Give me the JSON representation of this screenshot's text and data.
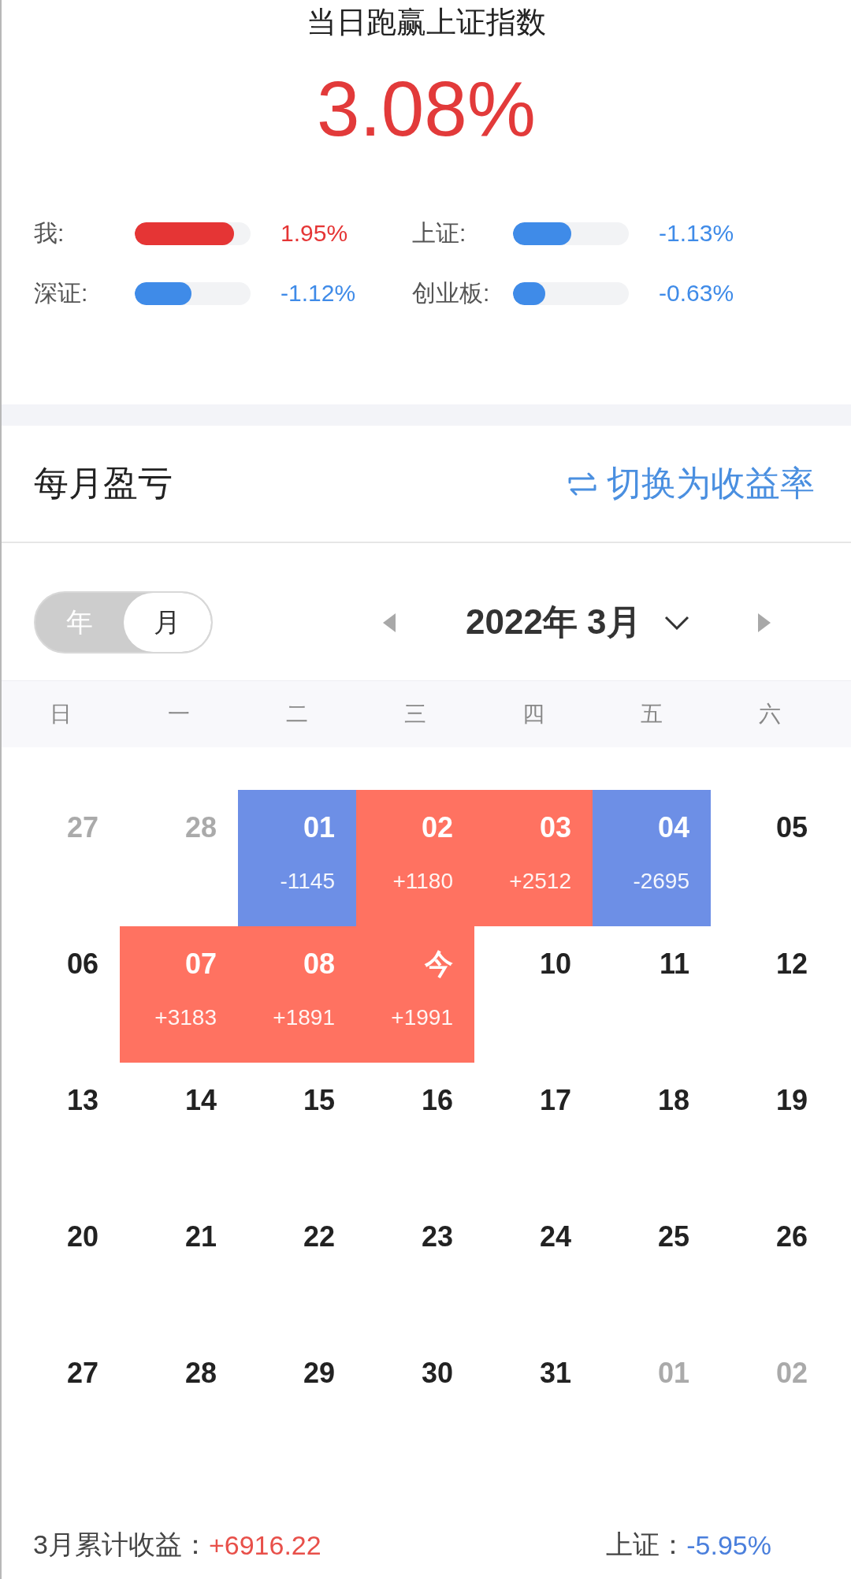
{
  "header": {
    "title": "当日跑赢上证指数",
    "value": "3.08%"
  },
  "comparisons": [
    {
      "label": "我:",
      "level": 0.86,
      "reading": "1.95%",
      "color": "#e53535"
    },
    {
      "label": "上证:",
      "level": 0.5,
      "reading": "-1.13%",
      "color": "#3f8be8"
    },
    {
      "label": "深证:",
      "level": 0.49,
      "reading": "-1.12%",
      "color": "#3f8be8"
    },
    {
      "label": "创业板:",
      "level": 0.28,
      "reading": "-0.63%",
      "color": "#3f8be8"
    }
  ],
  "section": {
    "title": "每月盈亏",
    "switch_link": "切换为收益率"
  },
  "mode_toggle": [
    {
      "label": "年",
      "selected": false
    },
    {
      "label": "月",
      "selected": true
    }
  ],
  "month_nav": {
    "label": "2022年 3月"
  },
  "weekdays": [
    "日",
    "一",
    "二",
    "三",
    "四",
    "五",
    "六"
  ],
  "weeks": [
    [
      {
        "day": "27",
        "kind": "outside"
      },
      {
        "day": "28",
        "kind": "outside"
      },
      {
        "day": "01",
        "kind": "loss",
        "pnl": "-1145"
      },
      {
        "day": "02",
        "kind": "gain",
        "pnl": "+1180"
      },
      {
        "day": "03",
        "kind": "gain",
        "pnl": "+2512"
      },
      {
        "day": "04",
        "kind": "loss",
        "pnl": "-2695"
      },
      {
        "day": "05",
        "kind": "day"
      }
    ],
    [
      {
        "day": "06",
        "kind": "day"
      },
      {
        "day": "07",
        "kind": "gain",
        "pnl": "+3183"
      },
      {
        "day": "08",
        "kind": "gain",
        "pnl": "+1891"
      },
      {
        "day": "今",
        "kind": "gain",
        "pnl": "+1991"
      },
      {
        "day": "10",
        "kind": "day"
      },
      {
        "day": "11",
        "kind": "day"
      },
      {
        "day": "12",
        "kind": "day"
      }
    ],
    [
      {
        "day": "13",
        "kind": "day"
      },
      {
        "day": "14",
        "kind": "day"
      },
      {
        "day": "15",
        "kind": "day"
      },
      {
        "day": "16",
        "kind": "day"
      },
      {
        "day": "17",
        "kind": "day"
      },
      {
        "day": "18",
        "kind": "day"
      },
      {
        "day": "19",
        "kind": "day"
      }
    ],
    [
      {
        "day": "20",
        "kind": "day"
      },
      {
        "day": "21",
        "kind": "day"
      },
      {
        "day": "22",
        "kind": "day"
      },
      {
        "day": "23",
        "kind": "day"
      },
      {
        "day": "24",
        "kind": "day"
      },
      {
        "day": "25",
        "kind": "day"
      },
      {
        "day": "26",
        "kind": "day"
      }
    ],
    [
      {
        "day": "27",
        "kind": "day"
      },
      {
        "day": "28",
        "kind": "day"
      },
      {
        "day": "29",
        "kind": "day"
      },
      {
        "day": "30",
        "kind": "day"
      },
      {
        "day": "31",
        "kind": "day"
      },
      {
        "day": "01",
        "kind": "outside"
      },
      {
        "day": "02",
        "kind": "outside"
      }
    ]
  ],
  "summary": {
    "label": "3月累计收益：",
    "value": "+6916.22",
    "index_label": "上证：",
    "index_value": "-5.95%"
  }
}
